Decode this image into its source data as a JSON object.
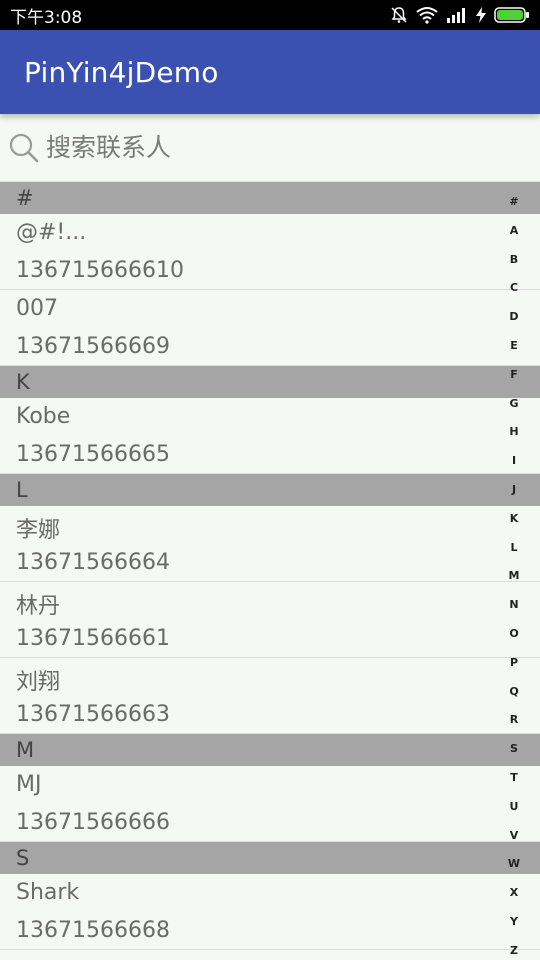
{
  "status_bar": {
    "time": "下午3:08"
  },
  "app_bar": {
    "title": "PinYin4jDemo"
  },
  "search": {
    "placeholder": "搜索联系人"
  },
  "sections": [
    {
      "letter": "#",
      "contacts": [
        {
          "name": "@#!...",
          "phone": "136715666610"
        },
        {
          "name": "007",
          "phone": "13671566669"
        }
      ]
    },
    {
      "letter": "K",
      "contacts": [
        {
          "name": "Kobe",
          "phone": "13671566665"
        }
      ]
    },
    {
      "letter": "L",
      "contacts": [
        {
          "name": "李娜",
          "phone": "13671566664"
        },
        {
          "name": "林丹",
          "phone": "13671566661"
        },
        {
          "name": "刘翔",
          "phone": "13671566663"
        }
      ]
    },
    {
      "letter": "M",
      "contacts": [
        {
          "name": "MJ",
          "phone": "13671566666"
        }
      ]
    },
    {
      "letter": "S",
      "contacts": [
        {
          "name": "Shark",
          "phone": "13671566668"
        }
      ]
    }
  ],
  "index_letters": [
    "#",
    "A",
    "B",
    "C",
    "D",
    "E",
    "F",
    "G",
    "H",
    "I",
    "J",
    "K",
    "L",
    "M",
    "N",
    "O",
    "P",
    "Q",
    "R",
    "S",
    "T",
    "U",
    "V",
    "W",
    "X",
    "Y",
    "Z"
  ],
  "colors": {
    "app_bar": "#3a51b2",
    "section_header": "#a5a5a5",
    "background": "#f4f9f3"
  },
  "icons": [
    "mute-icon",
    "wifi-icon",
    "signal-icon",
    "charging-icon",
    "battery-icon",
    "search-icon"
  ]
}
